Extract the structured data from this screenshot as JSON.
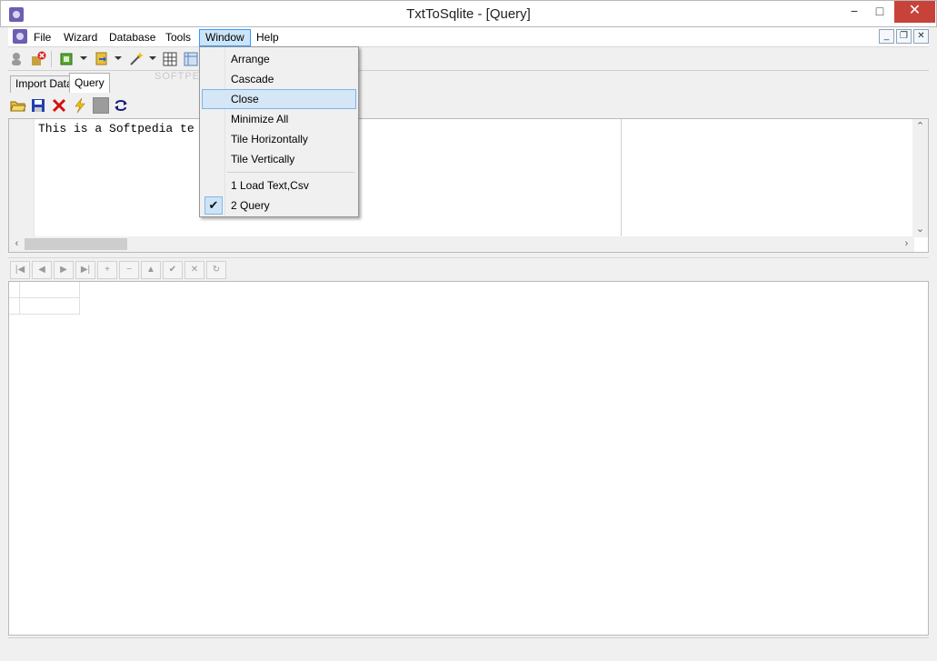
{
  "window": {
    "title": "TxtToSqlite - [Query]",
    "min_glyph": "−",
    "max_glyph": "□",
    "close_glyph": "✕"
  },
  "menubar": {
    "items": [
      "File",
      "Wizard",
      "Database",
      "Tools",
      "Window",
      "Help"
    ],
    "active": "Window",
    "mdi_controls": [
      "_",
      "❐",
      "✕"
    ]
  },
  "toolbar": {
    "icons": [
      "user-icon",
      "disconnect-icon",
      "copy-icon",
      "export-icon",
      "magic-wand-icon",
      "grid-icon",
      "table-icon"
    ]
  },
  "watermark": "SOFTPEDIA",
  "tabs": {
    "items": [
      "Import Data",
      "Query"
    ],
    "active": "Query"
  },
  "query_toolbar": {
    "icons": [
      "open-folder-icon",
      "save-icon",
      "delete-icon",
      "execute-icon",
      "stop-icon",
      "refresh-icon"
    ]
  },
  "editor": {
    "text": "This is a Softpedia te"
  },
  "navigator": {
    "buttons": [
      "|◀",
      "◀",
      "▶",
      "▶|",
      "+",
      "−",
      "▲",
      "✔",
      "✕",
      "↻"
    ],
    "names": [
      "first",
      "prior",
      "next",
      "last",
      "insert",
      "delete",
      "edit",
      "post",
      "cancel",
      "refresh"
    ]
  },
  "window_menu": {
    "items": [
      "Arrange",
      "Cascade",
      "Close",
      "Minimize All",
      "Tile Horizontally",
      "Tile Vertically"
    ],
    "highlighted": "Close",
    "windows": [
      "1 Load Text,Csv",
      "2 Query"
    ],
    "checked": "2 Query",
    "check_glyph": "✔"
  },
  "colors": {
    "accent": "#3399ff",
    "close_button": "#c7433a",
    "app_icon": "#6a5fb0"
  }
}
